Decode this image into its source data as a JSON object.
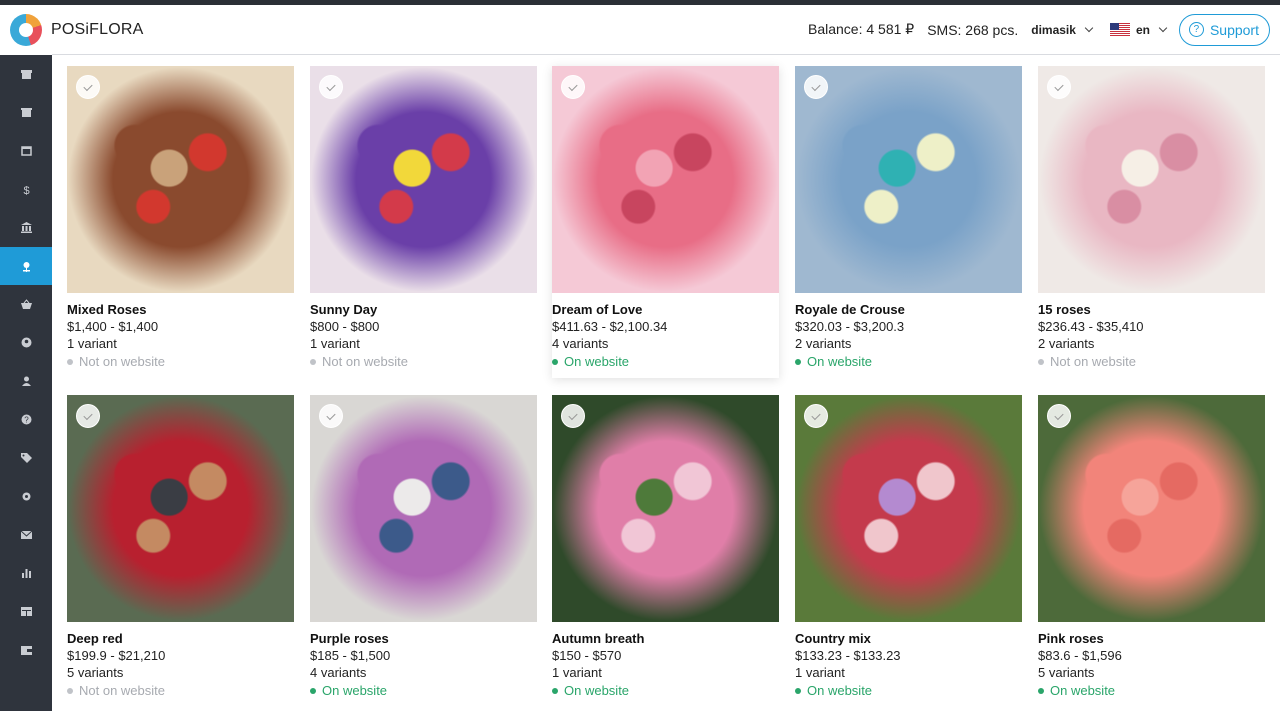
{
  "app": {
    "brand": "POSiFLORA",
    "accent": "#1f9bd7"
  },
  "header": {
    "balance": "Balance: 4 581 ₽",
    "sms": "SMS: 268 pcs.",
    "user": "dimasik",
    "language": "en",
    "support_label": "Support"
  },
  "sidebar": {
    "items": [
      {
        "icon": "store-icon"
      },
      {
        "icon": "shop-icon"
      },
      {
        "icon": "calendar-icon"
      },
      {
        "icon": "dollar-icon"
      },
      {
        "icon": "bank-icon"
      },
      {
        "icon": "flower-icon",
        "active": true
      },
      {
        "icon": "basket-icon"
      },
      {
        "icon": "customer-icon"
      },
      {
        "icon": "user-icon"
      },
      {
        "icon": "help-icon"
      },
      {
        "icon": "tag-icon"
      },
      {
        "icon": "settings-icon"
      },
      {
        "icon": "mail-icon"
      },
      {
        "icon": "chart-icon"
      },
      {
        "icon": "table-icon"
      },
      {
        "icon": "wallet-icon"
      }
    ]
  },
  "products": [
    {
      "name": "Mixed Roses",
      "price": "$1,400 - $1,400",
      "variants": "1 variant",
      "status": "Not on website",
      "on": false,
      "colors": [
        "#8a4a2e",
        "#c9a27a",
        "#d2382e",
        "#e8d9c0"
      ]
    },
    {
      "name": "Sunny Day",
      "price": "$800 - $800",
      "variants": "1 variant",
      "status": "Not on website",
      "on": false,
      "colors": [
        "#6a3fa8",
        "#f2d83a",
        "#d33a4a",
        "#eadfe8"
      ]
    },
    {
      "name": "Dream of Love",
      "price": "$411.63 - $2,100.34",
      "variants": "4 variants",
      "status": "On website",
      "on": true,
      "colors": [
        "#e86d86",
        "#f2a3b4",
        "#c8455f",
        "#f5c9d6"
      ]
    },
    {
      "name": "Royale de Crouse",
      "price": "$320.03 - $3,200.3",
      "variants": "2 variants",
      "status": "On website",
      "on": true,
      "colors": [
        "#7aa2c8",
        "#2fb1b3",
        "#eef0c8",
        "#9fb8d0"
      ]
    },
    {
      "name": "15 roses",
      "price": "$236.43 - $35,410",
      "variants": "2 variants",
      "status": "Not on website",
      "on": false,
      "colors": [
        "#e9b7c3",
        "#f6efe6",
        "#d98ea3",
        "#efe9e6"
      ]
    },
    {
      "name": "Deep red",
      "price": "$199.9 - $21,210",
      "variants": "5 variants",
      "status": "Not on website",
      "on": false,
      "colors": [
        "#b8202f",
        "#3a3d44",
        "#c48a62",
        "#5a6b52"
      ]
    },
    {
      "name": "Purple roses",
      "price": "$185 - $1,500",
      "variants": "4 variants",
      "status": "On website",
      "on": true,
      "colors": [
        "#b06ab6",
        "#eceaea",
        "#3c5a8a",
        "#d9d7d4"
      ]
    },
    {
      "name": "Autumn breath",
      "price": "$150 - $570",
      "variants": "1 variant",
      "status": "On website",
      "on": true,
      "colors": [
        "#e07ea8",
        "#4e7a3a",
        "#f1c6d6",
        "#2f4a2a"
      ]
    },
    {
      "name": "Country mix",
      "price": "$133.23 - $133.23",
      "variants": "1 variant",
      "status": "On website",
      "on": true,
      "colors": [
        "#c43a4c",
        "#b48ad0",
        "#f0c6cc",
        "#5a7a3a"
      ]
    },
    {
      "name": "Pink roses",
      "price": "$83.6 - $1,596",
      "variants": "5 variants",
      "status": "On website",
      "on": true,
      "colors": [
        "#f2847a",
        "#f6a49a",
        "#e56a62",
        "#4d6a3a"
      ]
    }
  ]
}
